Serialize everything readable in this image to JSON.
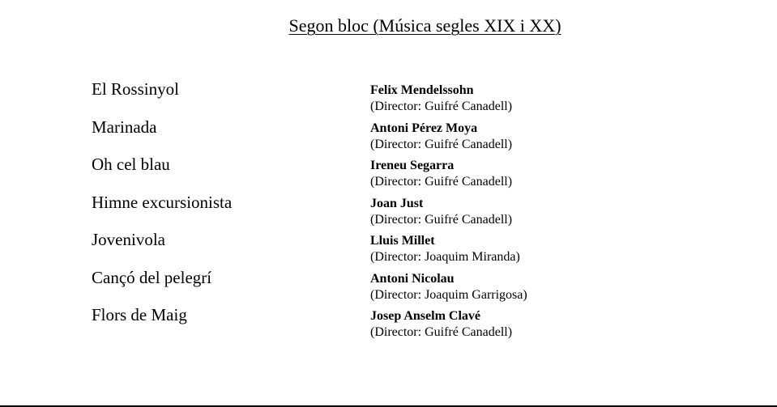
{
  "page": {
    "title": "Segon bloc (Música segles XIX i XX)"
  },
  "program": [
    {
      "piece": "El Rossinyol",
      "composer": "Felix Mendelssohn",
      "director": "(Director: Guifré Canadell)"
    },
    {
      "piece": "Marinada",
      "composer": "Antoni Pérez Moya",
      "director": "(Director: Guifré Canadell)"
    },
    {
      "piece": "Oh cel blau",
      "composer": "Ireneu Segarra",
      "director": "(Director: Guifré Canadell)"
    },
    {
      "piece": "Himne excursionista",
      "composer": "Joan Just",
      "director": "(Director: Guifré Canadell)"
    },
    {
      "piece": "Jovenivola",
      "composer": "Lluis Millet",
      "director": "(Director: Joaquim Miranda)"
    },
    {
      "piece": "Cançó del pelegrí",
      "composer": "Antoni Nicolau",
      "director": "(Director: Joaquim Garrigosa)"
    },
    {
      "piece": "Flors de Maig",
      "composer": "Josep Anselm Clavé",
      "director": "(Director: Guifré Canadell)"
    }
  ]
}
